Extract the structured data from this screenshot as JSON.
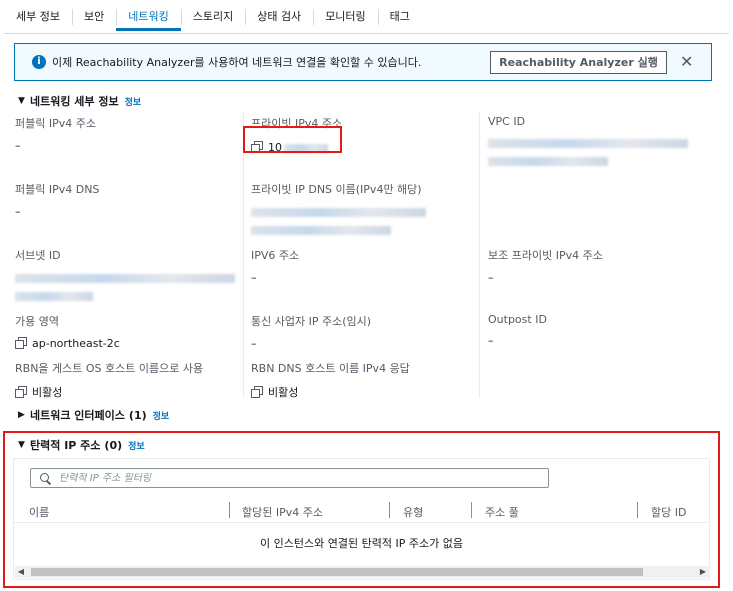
{
  "tabs": [
    {
      "label": "세부 정보"
    },
    {
      "label": "보안"
    },
    {
      "label": "네트워킹"
    },
    {
      "label": "스토리지"
    },
    {
      "label": "상태 검사"
    },
    {
      "label": "모니터링"
    },
    {
      "label": "태그"
    }
  ],
  "active_tab": "네트워킹",
  "alert": {
    "message": "이제 Reachability Analyzer를 사용하여 네트워크 연결을 확인할 수 있습니다.",
    "button_label": "Reachability Analyzer 실행",
    "close_glyph": "✕",
    "info_glyph": "i"
  },
  "networking_details": {
    "title": "네트워킹 세부 정보",
    "info_link": "정보",
    "caret": "▼",
    "fields": {
      "public_ipv4": {
        "label": "퍼블릭 IPv4 주소",
        "value": "–"
      },
      "private_ipv4": {
        "label": "프라이빗 IPv4 주소",
        "value": "10"
      },
      "vpc_id": {
        "label": "VPC ID",
        "value": ""
      },
      "public_ipv4_dns": {
        "label": "퍼블릭 IPv4 DNS",
        "value": "–"
      },
      "private_ip_dns": {
        "label": "프라이빗 IP DNS 이름(IPv4만 해당)",
        "value": ""
      },
      "subnet_id": {
        "label": "서브넷 ID",
        "value": ""
      },
      "ipv6": {
        "label": "IPV6 주소",
        "value": "–"
      },
      "secondary_private_ipv4": {
        "label": "보조 프라이빗 IPv4 주소",
        "value": "–"
      },
      "availability_zone": {
        "label": "가용 영역",
        "value": "ap-northeast-2c"
      },
      "carrier_ip": {
        "label": "통신 사업자 IP 주소(임시)",
        "value": "–"
      },
      "outpost_id": {
        "label": "Outpost ID",
        "value": "–"
      },
      "rbn_guest_os": {
        "label": "RBN을 게스트 OS 호스트 이름으로 사용",
        "value": "비활성"
      },
      "rbn_dns_ipv4": {
        "label": "RBN DNS 호스트 이름 IPv4 응답",
        "value": "비활성"
      }
    }
  },
  "network_interfaces": {
    "title": "네트워크 인터페이스",
    "count": "(1)",
    "info_link": "정보",
    "caret": "▶"
  },
  "elastic_ips": {
    "title": "탄력적 IP 주소",
    "count": "(0)",
    "info_link": "정보",
    "caret": "▼",
    "search_placeholder": "탄력적 IP 주소 필터링",
    "columns": [
      "이름",
      "할당된 IPv4 주소",
      "유형",
      "주소 풀",
      "할당 ID"
    ],
    "empty_message": "이 인스턴스와 연결된 탄력적 IP 주소가 없음"
  },
  "scrollbar": {
    "left_glyph": "◀",
    "right_glyph": "▶"
  },
  "colors": {
    "accent": "#0073bb",
    "highlight": "#e31b1b",
    "alert_bg": "#f1faff"
  }
}
